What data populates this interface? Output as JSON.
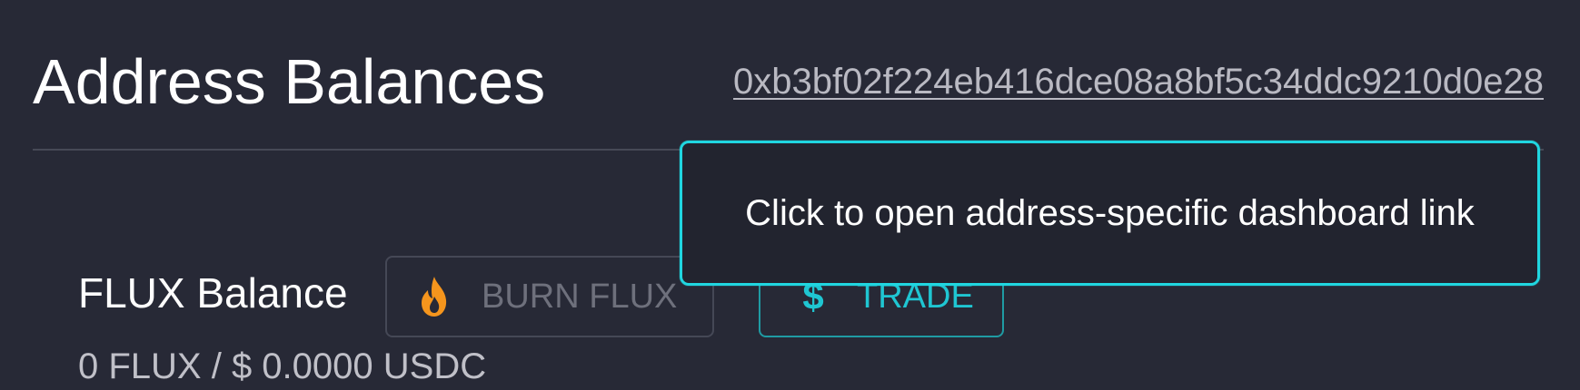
{
  "header": {
    "title": "Address Balances",
    "address": "0xb3bf02f224eb416dce08a8bf5c34ddc9210d0e28"
  },
  "tooltip": {
    "text": "Click to open address-specific dashboard link"
  },
  "flux": {
    "label": "FLUX Balance",
    "value": "0 FLUX / $ 0.0000 USDC",
    "burn_button": {
      "label": "BURN FLUX",
      "icon": "flame-icon"
    },
    "trade_button": {
      "label": "TRADE",
      "icon": "dollar-icon"
    }
  },
  "colors": {
    "background": "#272936",
    "accent": "#20d6e0",
    "flame": "#f5951d"
  }
}
